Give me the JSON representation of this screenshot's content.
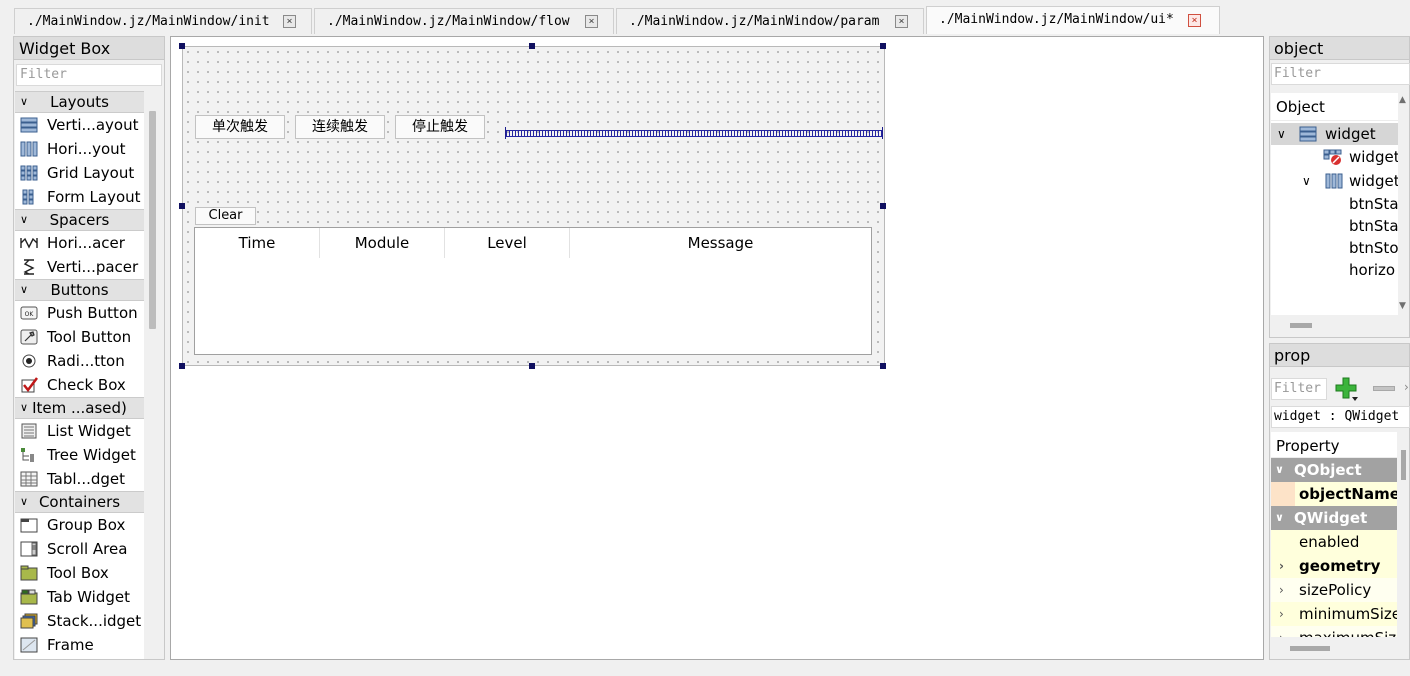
{
  "tabs": [
    {
      "label": "./MainWindow.jz/MainWindow/init",
      "close": "×"
    },
    {
      "label": "./MainWindow.jz/MainWindow/flow",
      "close": "×"
    },
    {
      "label": "./MainWindow.jz/MainWindow/param",
      "close": "×"
    },
    {
      "label": "./MainWindow.jz/MainWindow/ui*",
      "close": "×"
    }
  ],
  "widget_box": {
    "title": "Widget Box",
    "filter_placeholder": "Filter",
    "categories": [
      {
        "label": "Layouts",
        "items": [
          "Verti...ayout",
          "Hori...yout",
          "Grid Layout",
          "Form Layout"
        ]
      },
      {
        "label": "Spacers",
        "items": [
          "Hori...acer",
          "Verti...pacer"
        ]
      },
      {
        "label": "Buttons",
        "items": [
          "Push Button",
          "Tool Button",
          "Radi...tton",
          "Check Box"
        ]
      },
      {
        "label": "Item ...ased)",
        "items": [
          "List Widget",
          "Tree Widget",
          "Tabl...dget"
        ]
      },
      {
        "label": "Containers",
        "items": [
          "Group Box",
          "Scroll Area",
          "Tool Box",
          "Tab Widget",
          "Stack...idget",
          "Frame"
        ]
      }
    ]
  },
  "form": {
    "buttons": [
      "单次触发",
      "连续触发",
      "停止触发"
    ],
    "clear_label": "Clear",
    "log_columns": [
      "Time",
      "Module",
      "Level",
      "Message"
    ]
  },
  "object_inspector": {
    "title": "object",
    "filter_placeholder": "Filter",
    "header": "Object",
    "rows": [
      "widget",
      "widget",
      "widget",
      "btnSta",
      "btnSta",
      "btnSto",
      "horizo"
    ]
  },
  "property_editor": {
    "title": "prop",
    "filter_placeholder": "Filter",
    "class_label": "widget : QWidget",
    "header": "Property",
    "groups": [
      "QObject",
      "QWidget"
    ],
    "rows": [
      "objectName",
      "enabled",
      "geometry",
      "sizePolicy",
      "minimumSize",
      "maximumSize"
    ]
  }
}
